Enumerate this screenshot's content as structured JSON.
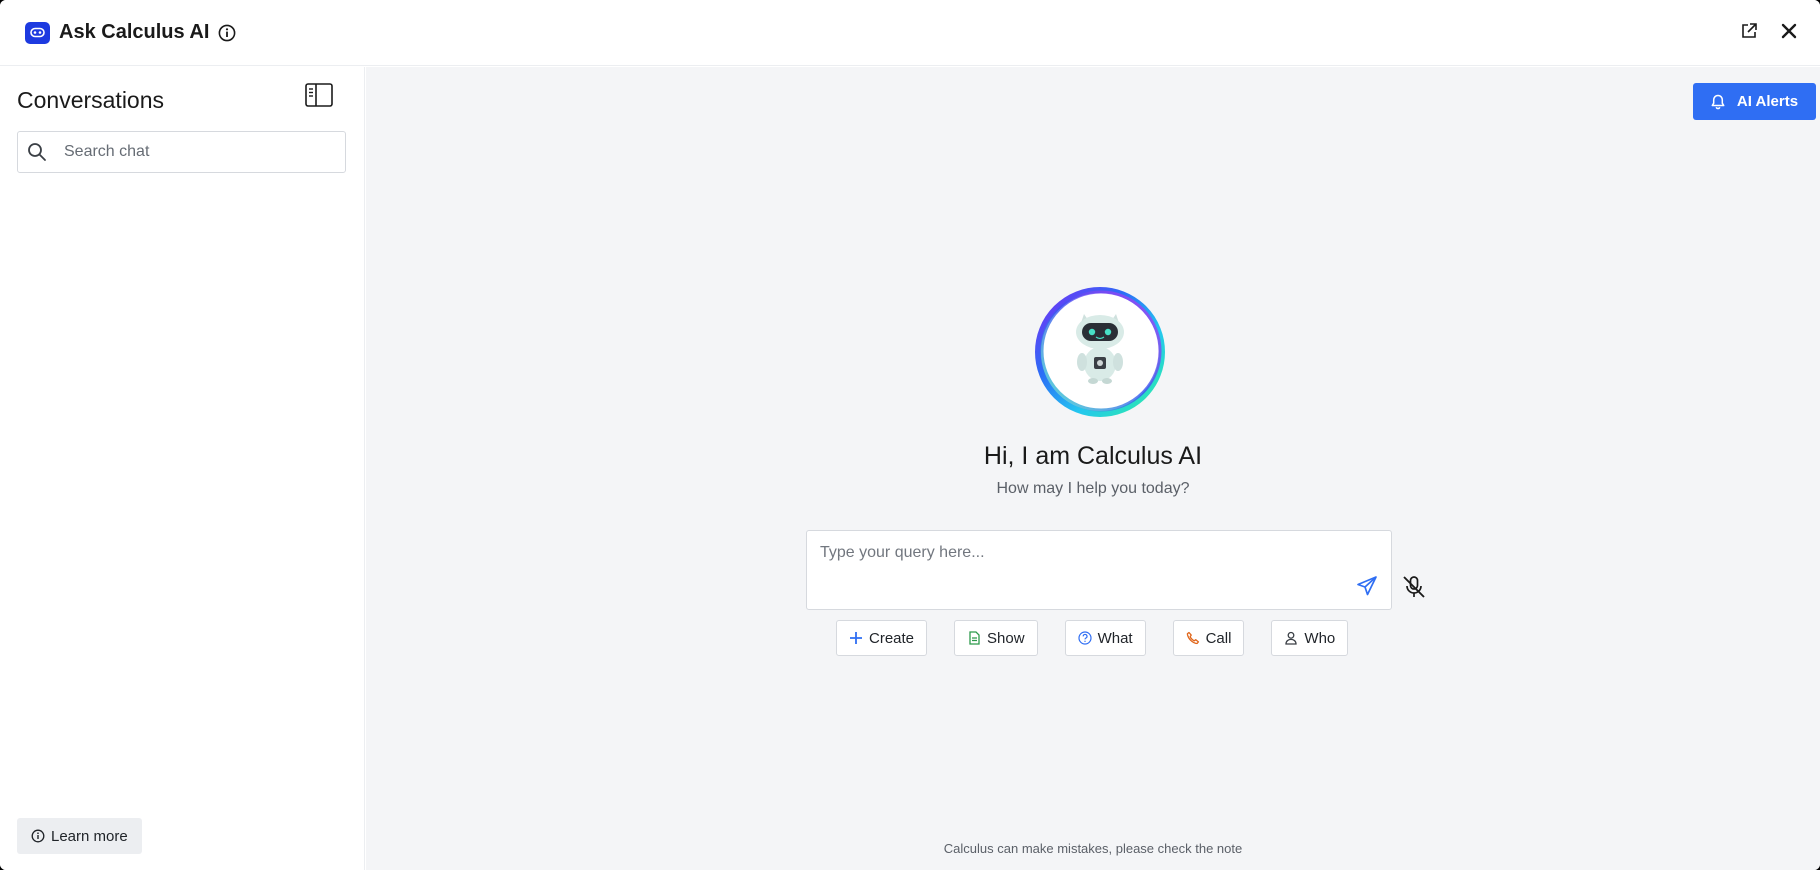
{
  "header": {
    "title": "Ask Calculus AI",
    "logo_icon": "robot-logo-icon",
    "accent_color": "#1d3ae0"
  },
  "sidebar": {
    "title": "Conversations",
    "search": {
      "placeholder": "Search chat",
      "value": ""
    },
    "learn_more_label": "Learn more"
  },
  "main": {
    "alerts_label": "AI Alerts",
    "alerts_color": "#2f6ef3",
    "greeting": "Hi, I am Calculus AI",
    "subtitle": "How may I help you today?",
    "query": {
      "placeholder": "Type your query here...",
      "value": ""
    },
    "chips": [
      {
        "label": "Create",
        "icon": "plus-icon",
        "color": "#2f6ef3"
      },
      {
        "label": "Show",
        "icon": "document-icon",
        "color": "#2c9a4b"
      },
      {
        "label": "What",
        "icon": "question-icon",
        "color": "#2f6ef3"
      },
      {
        "label": "Call",
        "icon": "phone-icon",
        "color": "#e0661b"
      },
      {
        "label": "Who",
        "icon": "user-icon",
        "color": "#3a3f45"
      }
    ],
    "disclaimer": "Calculus can make mistakes, please check the note"
  }
}
